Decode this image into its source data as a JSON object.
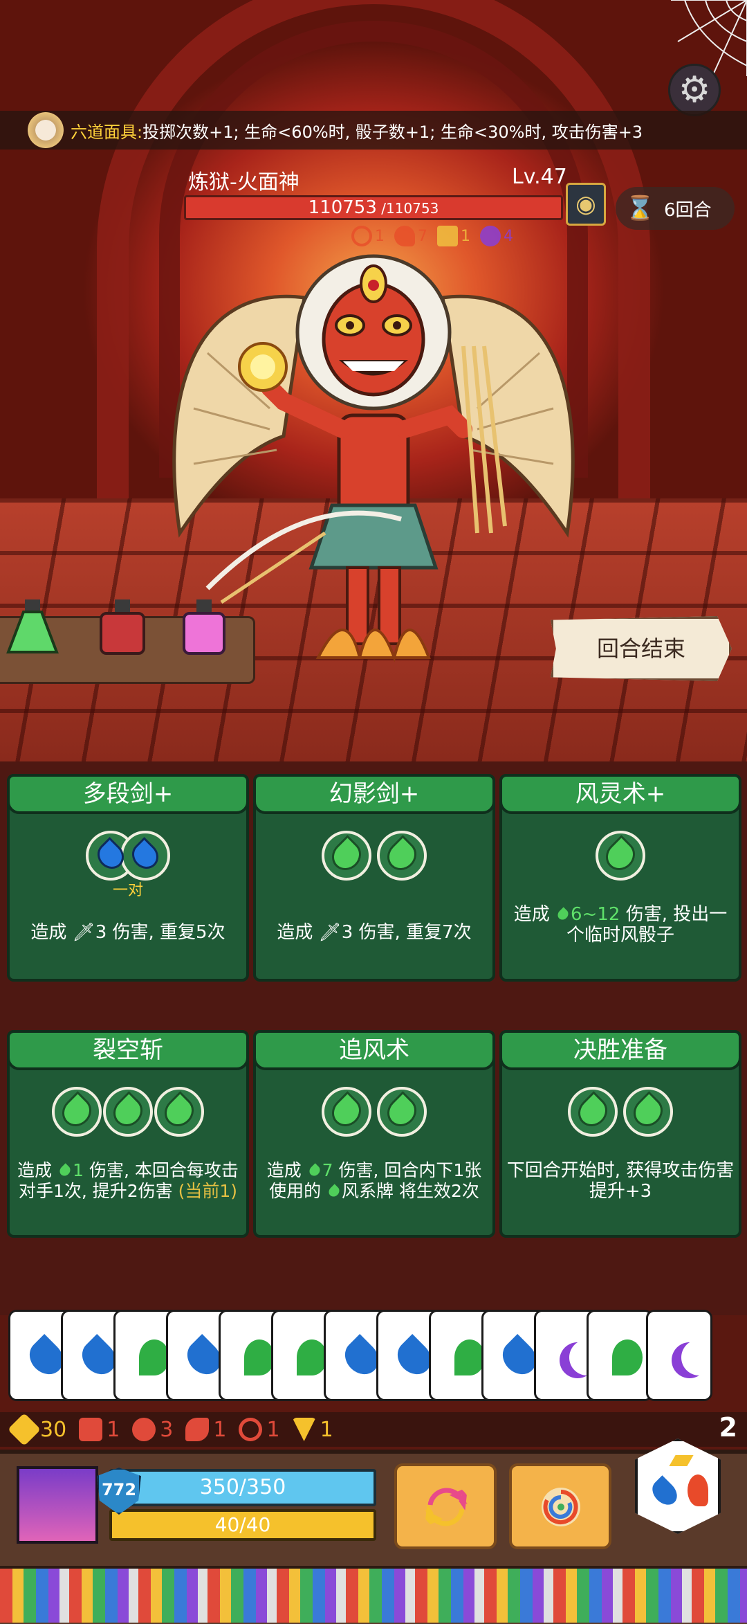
{
  "banner": {
    "mask_name": "六道面具:",
    "mask_desc": " 投掷次数+1; 生命<60%时, 骰子数+1; 生命<30%时, 攻击伤害+3"
  },
  "boss": {
    "name": "炼狱-火面神",
    "level": "Lv.47",
    "hp_current": "110753",
    "hp_max": " /110753",
    "intents": [
      {
        "icon": "spiral-icon",
        "value": "1",
        "color": "#e8502a"
      },
      {
        "icon": "flame-icon",
        "value": "7",
        "color": "#e8502a"
      },
      {
        "icon": "block-icon",
        "value": "1",
        "color": "#f0c040"
      },
      {
        "icon": "spider-icon",
        "value": "4",
        "color": "#8a3fd6"
      }
    ]
  },
  "round": {
    "label": "6回合"
  },
  "end_turn": {
    "label": "回合结束"
  },
  "cards": [
    {
      "title": "多段剑+",
      "cost_label": "一对",
      "desc": "造成 🗡3 伤害, 重复5次"
    },
    {
      "title": "幻影剑+",
      "desc": "造成 🗡3 伤害, 重复7次"
    },
    {
      "title": "风灵术+",
      "desc_a": "造成 ",
      "desc_num": "6~12",
      "desc_b": " 伤害, 投出一个临时风骰子"
    },
    {
      "title": "裂空斩",
      "desc_a": "造成 ",
      "desc_num": "1",
      "desc_b": " 伤害, 本回合每攻击对手1次, 提升2伤害 ",
      "desc_hl": "(当前1)"
    },
    {
      "title": "追风术",
      "desc_a": "造成 ",
      "desc_num": "7",
      "desc_b": " 伤害, 回合内下1张使用的 ",
      "desc_c": "风系牌 将生效2次"
    },
    {
      "title": "决胜准备",
      "desc": "下回合开始时, 获得攻击伤害提升+3"
    }
  ],
  "dice": [
    "water",
    "water",
    "wind",
    "water",
    "wind",
    "wind",
    "water",
    "water",
    "wind",
    "water",
    "moon",
    "wind",
    "moon"
  ],
  "status": [
    {
      "icon": "gold-icon",
      "value": "30",
      "color": "#f5c12c"
    },
    {
      "icon": "heart-shield-icon",
      "value": "1",
      "color": "#e04a3a"
    },
    {
      "icon": "claw-icon",
      "value": "3",
      "color": "#e04a3a"
    },
    {
      "icon": "horn-icon",
      "value": "1",
      "color": "#e04a3a"
    },
    {
      "icon": "target-icon",
      "value": "1",
      "color": "#e04a3a"
    },
    {
      "icon": "triangle-icon",
      "value": "1",
      "color": "#f5c12c"
    }
  ],
  "deck_count": "2",
  "player": {
    "shield": "772",
    "hp": "350/350",
    "energy": "40/40"
  }
}
